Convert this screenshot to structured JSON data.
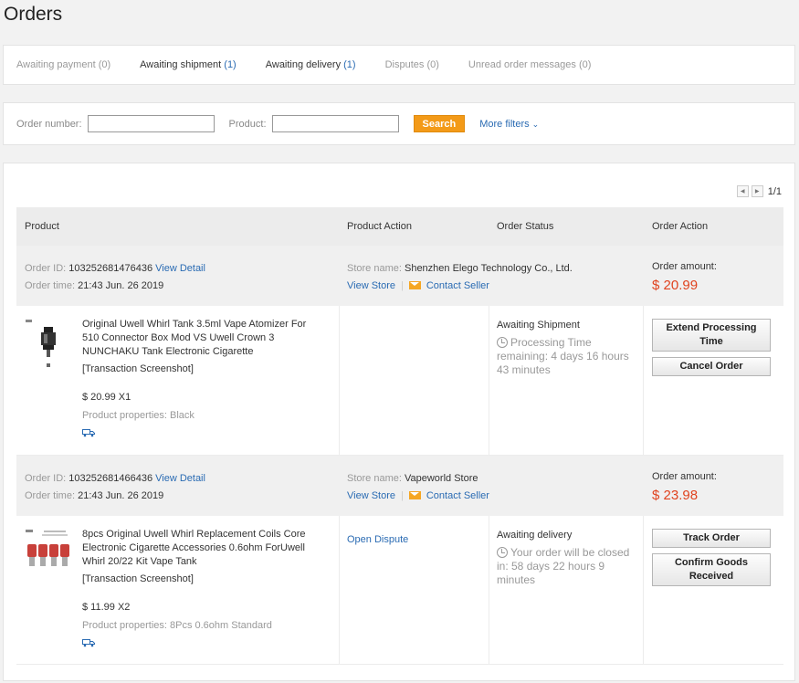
{
  "page": {
    "title": "Orders"
  },
  "tabs": [
    {
      "label": "Awaiting payment",
      "count": "(0)"
    },
    {
      "label": "Awaiting shipment",
      "count": "(1)"
    },
    {
      "label": "Awaiting delivery",
      "count": "(1)"
    },
    {
      "label": "Disputes",
      "count": "(0)"
    },
    {
      "label": "Unread order messages",
      "count": "(0)"
    }
  ],
  "filters": {
    "order_number_label": "Order number:",
    "order_number_value": "",
    "product_label": "Product:",
    "product_value": "",
    "search_label": "Search",
    "more_filters_label": "More filters"
  },
  "pagination": {
    "text": "1/1"
  },
  "table": {
    "headers": {
      "product": "Product",
      "product_action": "Product Action",
      "order_status": "Order Status",
      "order_action": "Order Action"
    }
  },
  "labels": {
    "order_id": "Order ID:",
    "order_time": "Order time:",
    "view_detail": "View Detail",
    "store_name": "Store name:",
    "view_store": "View Store",
    "sep": "|",
    "contact_seller": "Contact Seller",
    "order_amount": "Order amount:"
  },
  "orders": [
    {
      "id": "103252681476436",
      "time": "21:43 Jun. 26 2019",
      "store": "Shenzhen Elego Technology Co., Ltd.",
      "amount": "$ 20.99",
      "product_title": "Original Uwell Whirl Tank 3.5ml Vape Atomizer For 510 Connector Box Mod VS Uwell Crown 3 NUNCHAKU Tank Electronic Cigarette",
      "transaction": "[Transaction Screenshot]",
      "price_qty": "$ 20.99 X1",
      "properties": "Product properties: Black",
      "product_action": "",
      "status": "Awaiting Shipment",
      "remaining": "Processing Time remaining: 4 days 16 hours 43 minutes",
      "actions": [
        "Extend Processing Time",
        "Cancel Order"
      ]
    },
    {
      "id": "103252681466436",
      "time": "21:43 Jun. 26 2019",
      "store": "Vapeworld Store",
      "amount": "$ 23.98",
      "product_title": "8pcs Original Uwell Whirl Replacement Coils Core Electronic Cigarette Accessories 0.6ohm ForUwell Whirl 20/22 Kit Vape Tank",
      "transaction": "[Transaction Screenshot]",
      "price_qty": "$ 11.99 X2",
      "properties": "Product properties: 8Pcs 0.6ohm Standard",
      "product_action": "Open Dispute",
      "status": "Awaiting delivery",
      "remaining": "Your order will be closed in: 58 days 22 hours 9 minutes",
      "actions": [
        "Track Order",
        "Confirm Goods Received"
      ]
    }
  ],
  "icons": {
    "pager_prev": "triangle-left-icon",
    "pager_next": "triangle-right-icon",
    "chevron": "chevron-down-icon",
    "mail": "envelope-icon",
    "clock": "clock-icon",
    "truck": "truck-icon"
  },
  "colors": {
    "link": "#2a6bb3",
    "accent": "#f39a18",
    "amount": "#e0431f"
  }
}
